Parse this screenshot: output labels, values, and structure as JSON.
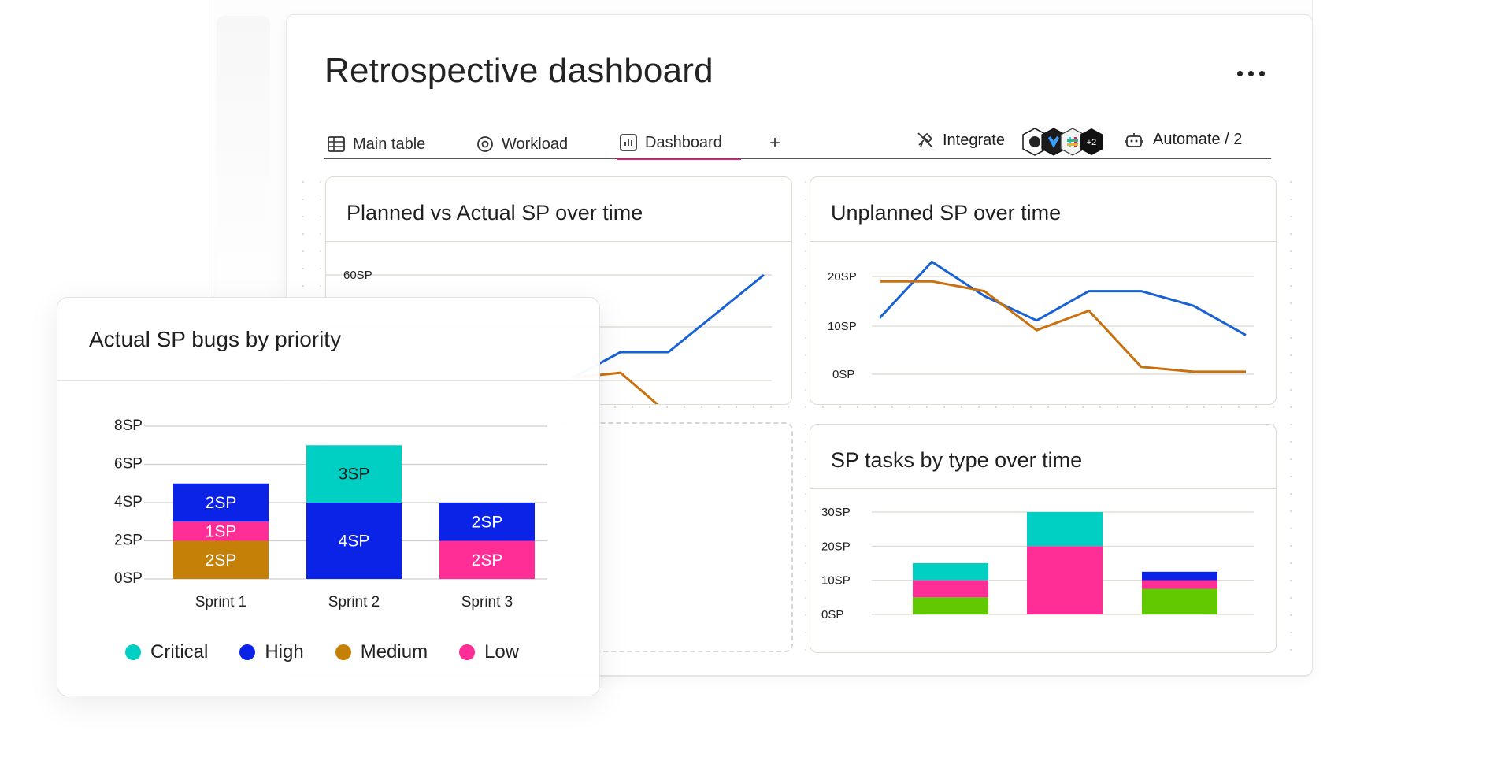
{
  "page": {
    "title": "Retrospective dashboard",
    "more_icon": "more-horizontal-icon"
  },
  "tabs": [
    {
      "label": "Main table",
      "icon": "table-icon"
    },
    {
      "label": "Workload",
      "icon": "workload-icon"
    },
    {
      "label": "Dashboard",
      "icon": "dashboard-icon",
      "active": true
    }
  ],
  "add_tab_label": "+",
  "integrate": {
    "label": "Integrate",
    "icon": "integrate-icon",
    "extra_count": "+2"
  },
  "automate": {
    "label": "Automate / 2",
    "icon": "robot-icon"
  },
  "colors": {
    "accent": "#e0247a",
    "blue": "#1862d6",
    "orange": "#c9710e",
    "critical": "#00cfc4",
    "high": "#0a23e6",
    "medium": "#c58107",
    "low": "#ff2d96",
    "green": "#62c800"
  },
  "chart_data": [
    {
      "type": "line",
      "title": "Planned vs Actual SP over time",
      "yticks": [
        "60SP"
      ],
      "ylim": [
        0,
        60
      ],
      "x": [
        1,
        2,
        3,
        4,
        5,
        6,
        7,
        8,
        9
      ],
      "series": [
        {
          "values": [
            null,
            null,
            null,
            null,
            null,
            20,
            30,
            30,
            45,
            60
          ]
        },
        {
          "values": [
            null,
            null,
            null,
            null,
            null,
            20,
            22,
            6,
            5,
            5
          ]
        }
      ]
    },
    {
      "type": "line",
      "title": "Unplanned SP over time",
      "yticks": [
        "20SP",
        "10SP",
        "0SP"
      ],
      "ylim": [
        0,
        20
      ],
      "x": [
        1,
        2,
        3,
        4,
        5,
        6,
        7,
        8
      ],
      "series": [
        {
          "values": [
            11.5,
            23,
            16,
            11,
            17,
            17,
            14,
            8
          ]
        },
        {
          "values": [
            19,
            19,
            17,
            9,
            13,
            1.5,
            0.5,
            0.5
          ]
        }
      ]
    },
    {
      "type": "bar",
      "title": "SP tasks by type over time",
      "yticks": [
        "30SP",
        "20SP",
        "10SP",
        "0SP"
      ],
      "ylim": [
        0,
        30
      ],
      "categories": [
        "",
        "",
        ""
      ],
      "series": [
        {
          "color": "green",
          "values": [
            5,
            0,
            7.5
          ]
        },
        {
          "color": "low",
          "values": [
            5,
            20,
            2.5
          ]
        },
        {
          "color": "critical",
          "values": [
            5,
            10,
            0
          ]
        },
        {
          "color": "high",
          "values": [
            0,
            0,
            2.5
          ]
        }
      ]
    },
    {
      "type": "bar",
      "title": "Actual SP bugs by priority",
      "yticks": [
        "8SP",
        "6SP",
        "4SP",
        "2SP",
        "0SP"
      ],
      "ylim": [
        0,
        8
      ],
      "categories": [
        "Sprint 1",
        "Sprint 2",
        "Sprint 3"
      ],
      "series": [
        {
          "name": "Medium",
          "color": "medium",
          "values": [
            2,
            0,
            0
          ],
          "labels": [
            "2SP",
            "",
            ""
          ]
        },
        {
          "name": "Low",
          "color": "low",
          "values": [
            1,
            0,
            2
          ],
          "labels": [
            "1SP",
            "",
            "2SP"
          ]
        },
        {
          "name": "High",
          "color": "high",
          "values": [
            2,
            4,
            2
          ],
          "labels": [
            "2SP",
            "4SP",
            "2SP"
          ]
        },
        {
          "name": "Critical",
          "color": "critical",
          "values": [
            0,
            3,
            0
          ],
          "labels": [
            "",
            "3SP",
            ""
          ]
        }
      ],
      "legend": [
        "Critical",
        "High",
        "Medium",
        "Low"
      ]
    }
  ]
}
